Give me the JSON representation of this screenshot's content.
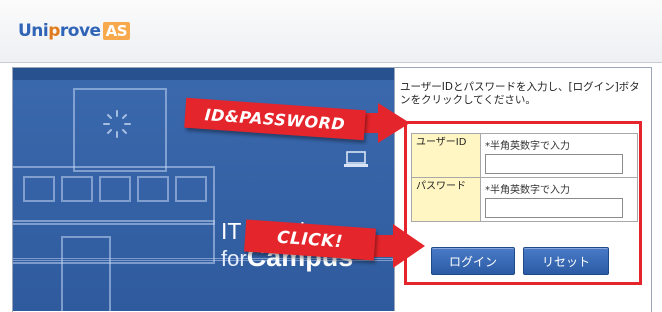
{
  "header": {
    "logo_main_prefix": "Uni",
    "logo_main_accent": "p",
    "logo_main_suffix": "rove",
    "logo_badge": "AS"
  },
  "hero": {
    "line1": "IT Solution",
    "line2_small": "for",
    "line2_big": "Campus"
  },
  "login": {
    "instructions": "ユーザーIDとパスワードを入力し、[ログイン]ボタンをクリックしてください。",
    "user_id_label": "ユーザーID",
    "user_id_hint": "*半角英数字で入力",
    "user_id_value": "",
    "password_label": "パスワード",
    "password_hint": "*半角英数字で入力",
    "password_value": "",
    "login_button": "ログイン",
    "reset_button": "リセット"
  },
  "callouts": {
    "id_password": "ID&PASSWORD",
    "click": "CLICK!"
  },
  "colors": {
    "brand_blue": "#2f64b7",
    "brand_orange": "#f7a94b",
    "hero_blue": "#3b69ad",
    "highlight_red": "#e4252b",
    "label_yellow": "#fff6c4",
    "button_blue": "#2b5ba5"
  }
}
